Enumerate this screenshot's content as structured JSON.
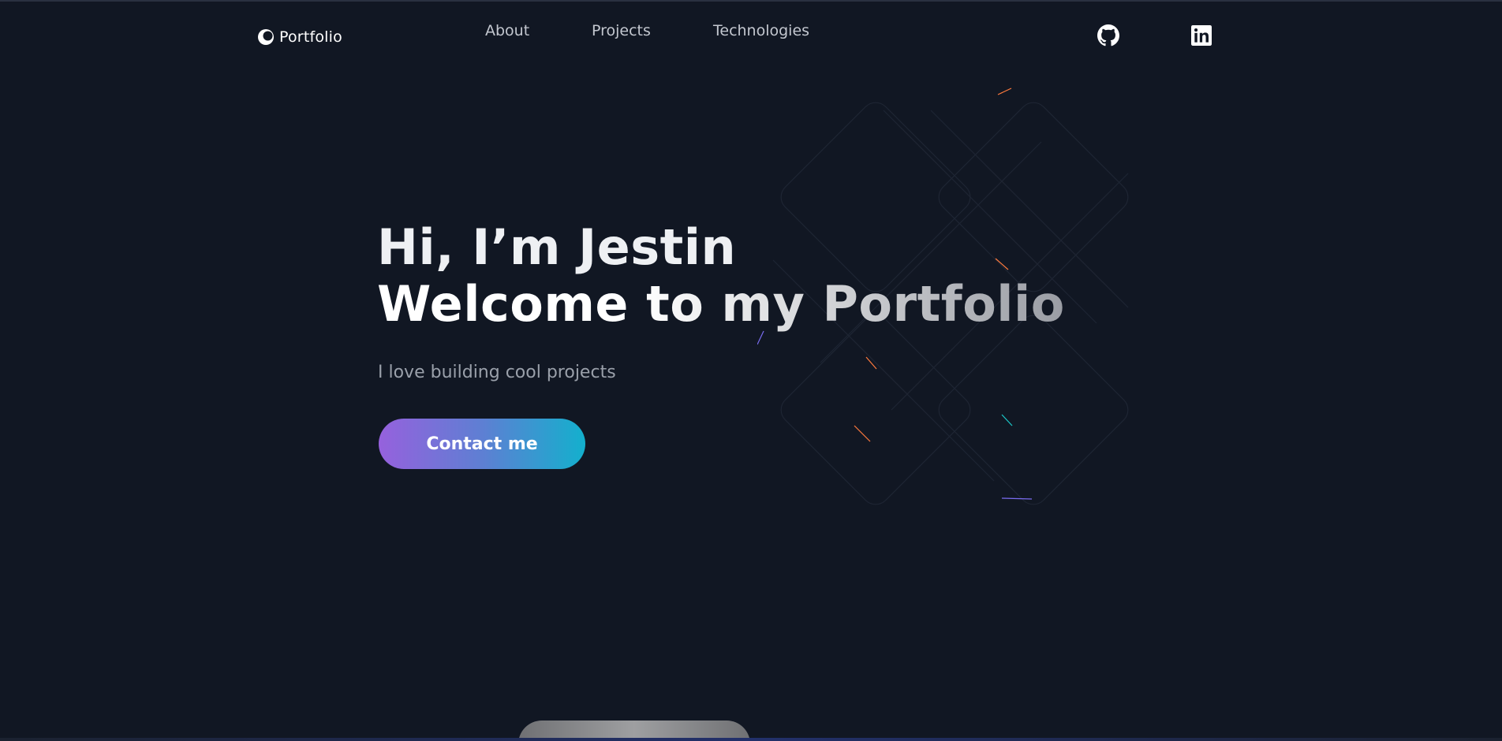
{
  "nav": {
    "brand": "Portfolio",
    "links": [
      "About",
      "Projects",
      "Technologies"
    ]
  },
  "social": {
    "github_icon": "github-icon",
    "linkedin_icon": "linkedin-icon"
  },
  "hero": {
    "greeting": "Hi, I’m Jestin",
    "headline": "Welcome to my Portfolio",
    "tagline": "I love building cool projects",
    "cta_label": "Contact me"
  },
  "colors": {
    "background": "#111723",
    "cta_gradient_start": "#9661dd",
    "cta_gradient_end": "#13b0cd"
  }
}
